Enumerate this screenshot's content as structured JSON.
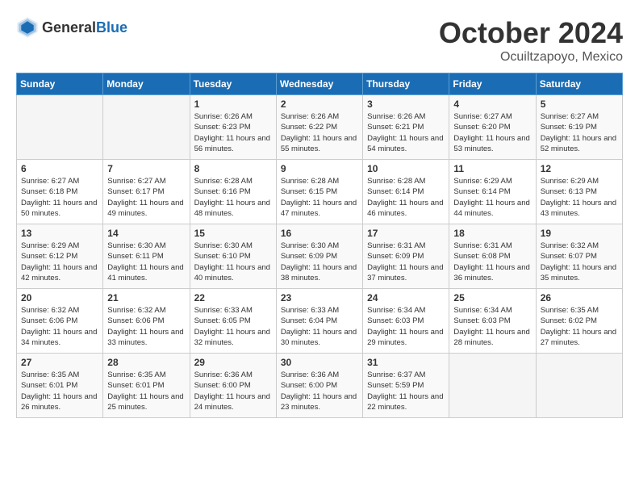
{
  "header": {
    "logo_general": "General",
    "logo_blue": "Blue",
    "month": "October 2024",
    "location": "Ocuiltzapoyo, Mexico"
  },
  "weekdays": [
    "Sunday",
    "Monday",
    "Tuesday",
    "Wednesday",
    "Thursday",
    "Friday",
    "Saturday"
  ],
  "weeks": [
    [
      {
        "day": "",
        "sunrise": "",
        "sunset": "",
        "daylight": ""
      },
      {
        "day": "",
        "sunrise": "",
        "sunset": "",
        "daylight": ""
      },
      {
        "day": "1",
        "sunrise": "Sunrise: 6:26 AM",
        "sunset": "Sunset: 6:23 PM",
        "daylight": "Daylight: 11 hours and 56 minutes."
      },
      {
        "day": "2",
        "sunrise": "Sunrise: 6:26 AM",
        "sunset": "Sunset: 6:22 PM",
        "daylight": "Daylight: 11 hours and 55 minutes."
      },
      {
        "day": "3",
        "sunrise": "Sunrise: 6:26 AM",
        "sunset": "Sunset: 6:21 PM",
        "daylight": "Daylight: 11 hours and 54 minutes."
      },
      {
        "day": "4",
        "sunrise": "Sunrise: 6:27 AM",
        "sunset": "Sunset: 6:20 PM",
        "daylight": "Daylight: 11 hours and 53 minutes."
      },
      {
        "day": "5",
        "sunrise": "Sunrise: 6:27 AM",
        "sunset": "Sunset: 6:19 PM",
        "daylight": "Daylight: 11 hours and 52 minutes."
      }
    ],
    [
      {
        "day": "6",
        "sunrise": "Sunrise: 6:27 AM",
        "sunset": "Sunset: 6:18 PM",
        "daylight": "Daylight: 11 hours and 50 minutes."
      },
      {
        "day": "7",
        "sunrise": "Sunrise: 6:27 AM",
        "sunset": "Sunset: 6:17 PM",
        "daylight": "Daylight: 11 hours and 49 minutes."
      },
      {
        "day": "8",
        "sunrise": "Sunrise: 6:28 AM",
        "sunset": "Sunset: 6:16 PM",
        "daylight": "Daylight: 11 hours and 48 minutes."
      },
      {
        "day": "9",
        "sunrise": "Sunrise: 6:28 AM",
        "sunset": "Sunset: 6:15 PM",
        "daylight": "Daylight: 11 hours and 47 minutes."
      },
      {
        "day": "10",
        "sunrise": "Sunrise: 6:28 AM",
        "sunset": "Sunset: 6:14 PM",
        "daylight": "Daylight: 11 hours and 46 minutes."
      },
      {
        "day": "11",
        "sunrise": "Sunrise: 6:29 AM",
        "sunset": "Sunset: 6:14 PM",
        "daylight": "Daylight: 11 hours and 44 minutes."
      },
      {
        "day": "12",
        "sunrise": "Sunrise: 6:29 AM",
        "sunset": "Sunset: 6:13 PM",
        "daylight": "Daylight: 11 hours and 43 minutes."
      }
    ],
    [
      {
        "day": "13",
        "sunrise": "Sunrise: 6:29 AM",
        "sunset": "Sunset: 6:12 PM",
        "daylight": "Daylight: 11 hours and 42 minutes."
      },
      {
        "day": "14",
        "sunrise": "Sunrise: 6:30 AM",
        "sunset": "Sunset: 6:11 PM",
        "daylight": "Daylight: 11 hours and 41 minutes."
      },
      {
        "day": "15",
        "sunrise": "Sunrise: 6:30 AM",
        "sunset": "Sunset: 6:10 PM",
        "daylight": "Daylight: 11 hours and 40 minutes."
      },
      {
        "day": "16",
        "sunrise": "Sunrise: 6:30 AM",
        "sunset": "Sunset: 6:09 PM",
        "daylight": "Daylight: 11 hours and 38 minutes."
      },
      {
        "day": "17",
        "sunrise": "Sunrise: 6:31 AM",
        "sunset": "Sunset: 6:09 PM",
        "daylight": "Daylight: 11 hours and 37 minutes."
      },
      {
        "day": "18",
        "sunrise": "Sunrise: 6:31 AM",
        "sunset": "Sunset: 6:08 PM",
        "daylight": "Daylight: 11 hours and 36 minutes."
      },
      {
        "day": "19",
        "sunrise": "Sunrise: 6:32 AM",
        "sunset": "Sunset: 6:07 PM",
        "daylight": "Daylight: 11 hours and 35 minutes."
      }
    ],
    [
      {
        "day": "20",
        "sunrise": "Sunrise: 6:32 AM",
        "sunset": "Sunset: 6:06 PM",
        "daylight": "Daylight: 11 hours and 34 minutes."
      },
      {
        "day": "21",
        "sunrise": "Sunrise: 6:32 AM",
        "sunset": "Sunset: 6:06 PM",
        "daylight": "Daylight: 11 hours and 33 minutes."
      },
      {
        "day": "22",
        "sunrise": "Sunrise: 6:33 AM",
        "sunset": "Sunset: 6:05 PM",
        "daylight": "Daylight: 11 hours and 32 minutes."
      },
      {
        "day": "23",
        "sunrise": "Sunrise: 6:33 AM",
        "sunset": "Sunset: 6:04 PM",
        "daylight": "Daylight: 11 hours and 30 minutes."
      },
      {
        "day": "24",
        "sunrise": "Sunrise: 6:34 AM",
        "sunset": "Sunset: 6:03 PM",
        "daylight": "Daylight: 11 hours and 29 minutes."
      },
      {
        "day": "25",
        "sunrise": "Sunrise: 6:34 AM",
        "sunset": "Sunset: 6:03 PM",
        "daylight": "Daylight: 11 hours and 28 minutes."
      },
      {
        "day": "26",
        "sunrise": "Sunrise: 6:35 AM",
        "sunset": "Sunset: 6:02 PM",
        "daylight": "Daylight: 11 hours and 27 minutes."
      }
    ],
    [
      {
        "day": "27",
        "sunrise": "Sunrise: 6:35 AM",
        "sunset": "Sunset: 6:01 PM",
        "daylight": "Daylight: 11 hours and 26 minutes."
      },
      {
        "day": "28",
        "sunrise": "Sunrise: 6:35 AM",
        "sunset": "Sunset: 6:01 PM",
        "daylight": "Daylight: 11 hours and 25 minutes."
      },
      {
        "day": "29",
        "sunrise": "Sunrise: 6:36 AM",
        "sunset": "Sunset: 6:00 PM",
        "daylight": "Daylight: 11 hours and 24 minutes."
      },
      {
        "day": "30",
        "sunrise": "Sunrise: 6:36 AM",
        "sunset": "Sunset: 6:00 PM",
        "daylight": "Daylight: 11 hours and 23 minutes."
      },
      {
        "day": "31",
        "sunrise": "Sunrise: 6:37 AM",
        "sunset": "Sunset: 5:59 PM",
        "daylight": "Daylight: 11 hours and 22 minutes."
      },
      {
        "day": "",
        "sunrise": "",
        "sunset": "",
        "daylight": ""
      },
      {
        "day": "",
        "sunrise": "",
        "sunset": "",
        "daylight": ""
      }
    ]
  ]
}
